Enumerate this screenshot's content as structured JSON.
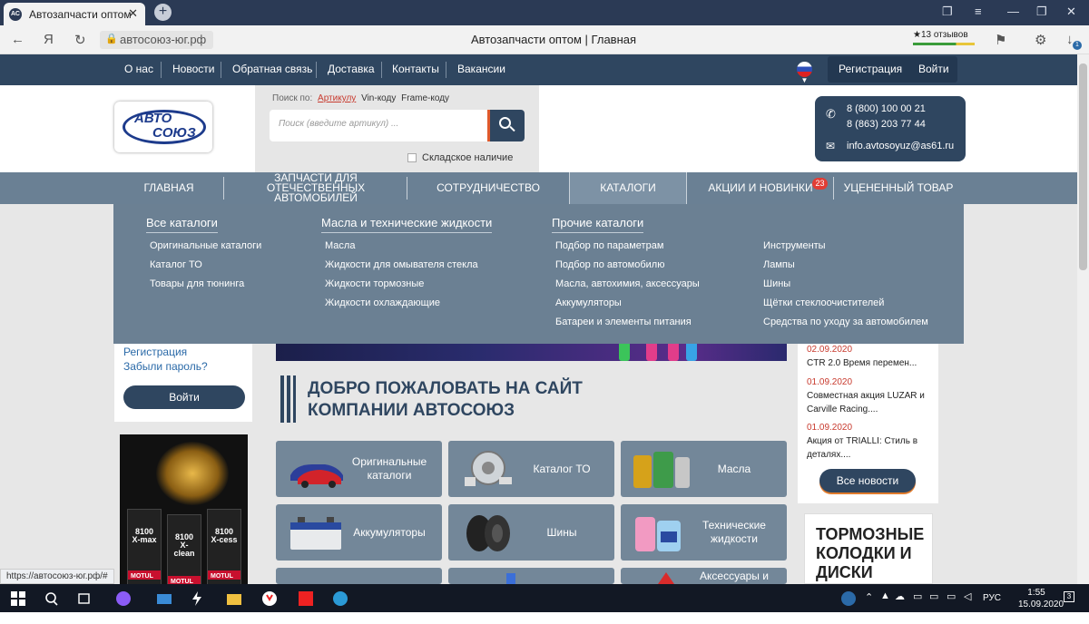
{
  "browser": {
    "tab_title": "Автозапчасти оптом",
    "tab_favicon": "АС",
    "url": "автосоюз-юг.рф",
    "page_title": "Автозапчасти оптом | Главная",
    "reviews": "★13 отзывов",
    "yandex_glyph": "Я",
    "downloads_badge": "1"
  },
  "topnav": {
    "items": [
      "О нас",
      "Новости",
      "Обратная связь",
      "Доставка",
      "Контакты",
      "Вакансии"
    ],
    "register": "Регистрация",
    "login": "Войти"
  },
  "logo": {
    "line1": "АВТО",
    "line2": "СОЮЗ"
  },
  "search": {
    "label": "Поиск по:",
    "modes": [
      "Артикулу",
      "Vin-коду",
      "Frame-коду"
    ],
    "placeholder": "Поиск (введите артикул) ...",
    "stock_label": "Складское наличие"
  },
  "contacts": {
    "phone1": "8 (800) 100 00 21",
    "phone2": "8 (863) 203 77 44",
    "email": "info.avtosoyuz@as61.ru"
  },
  "mainnav": {
    "items": [
      "ГЛАВНАЯ",
      "ЗАПЧАСТИ ДЛЯ ОТЕЧЕСТВЕННЫХ АВТОМОБИЛЕЙ",
      "СОТРУДНИЧЕСТВО",
      "КАТАЛОГИ",
      "АКЦИИ И НОВИНКИ",
      "УЦЕНЕННЫЙ ТОВАР"
    ],
    "badge": "23"
  },
  "dropdown": {
    "col1": {
      "title": "Все каталоги",
      "items": [
        "Оригинальные каталоги",
        "Каталог ТО",
        "Товары для тюнинга"
      ]
    },
    "col2": {
      "title": "Масла и технические жидкости",
      "items": [
        "Масла",
        "Жидкости для омывателя стекла",
        "Жидкости тормозные",
        "Жидкости охлаждающие"
      ]
    },
    "col3": {
      "title": "Прочие каталоги",
      "items": [
        "Подбор по параметрам",
        "Подбор по автомобилю",
        "Масла, автохимия, аксессуары",
        "Аккумуляторы",
        "Батареи и элементы питания"
      ]
    },
    "col4": {
      "items": [
        "Инструменты",
        "Лампы",
        "Шины",
        "Щётки стеклоочистителей",
        "Средства по уходу за автомобилем"
      ]
    }
  },
  "left": {
    "register": "Регистрация",
    "forgot": "Забыли пароль?",
    "login_button": "Войти",
    "ad_labels": [
      "8100 X-max",
      "8100 X-clean",
      "8100 X-cess"
    ],
    "ad_brand": "MOTUL"
  },
  "welcome": {
    "line1": "ДОБРО ПОЖАЛОВАТЬ НА САЙТ",
    "line2": "КОМПАНИИ АВТОСОЮЗ"
  },
  "tiles": [
    "Оригинальные каталоги",
    "Каталог ТО",
    "Масла",
    "Аккумуляторы",
    "Шины",
    "Технические жидкости",
    "",
    "",
    "Аксессуары и"
  ],
  "news": {
    "items": [
      {
        "date": "02.09.2020",
        "text": "CTR 2.0 Время перемен..."
      },
      {
        "date": "01.09.2020",
        "text": "Совместная акция LUZAR и Carville Racing...."
      },
      {
        "date": "01.09.2020",
        "text": "Акция от TRIALLI: Стиль в деталях...."
      }
    ],
    "all_button": "Все новости"
  },
  "ad_right": {
    "text": "ТОРМОЗНЫЕ КОЛОДКИ И ДИСКИ"
  },
  "status_url": "https://автосоюз-юг.рф/#",
  "taskbar": {
    "lang": "РУС",
    "time": "1:55",
    "date": "15.09.2020",
    "notif": "3"
  },
  "colors": {
    "navy": "#2f4660",
    "slate": "#6a8094",
    "accent_red": "#c83a2e",
    "orange": "#e05a2c"
  }
}
